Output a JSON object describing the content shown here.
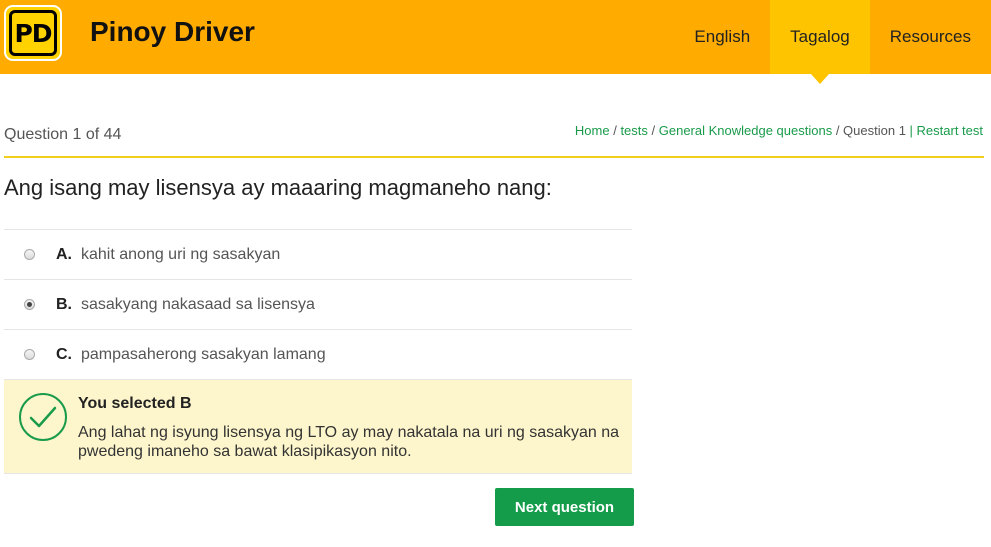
{
  "header": {
    "logo_text": "PD",
    "brand": "Pinoy Driver",
    "logo_color": "#ffd200",
    "bar_color": "#ffab00",
    "nav": [
      {
        "label": "English",
        "active": false
      },
      {
        "label": "Tagalog",
        "active": true
      },
      {
        "label": "Resources",
        "active": false
      }
    ]
  },
  "quiz": {
    "progress": "Question 1 of 44",
    "breadcrumb": {
      "home": "Home",
      "sep": " / ",
      "tests": "tests",
      "category": "General Knowledge questions",
      "current": "Question 1",
      "bar": " | ",
      "restart": "Restart test"
    },
    "question": "Ang isang may lisensya ay maaaring magmaneho nang:",
    "options": [
      {
        "letter": "A.",
        "text": "kahit anong uri ng sasakyan",
        "selected": false
      },
      {
        "letter": "B.",
        "text": "sasakyang nakasaad sa lisensya",
        "selected": true
      },
      {
        "letter": "C.",
        "text": "pampasaherong sasakyan lamang",
        "selected": false
      }
    ],
    "feedback": {
      "icon": "check-circle-icon",
      "title": "You selected B",
      "text": "Ang lahat ng isyung lisensya ng LTO ay may nakatala na uri ng sasakyan na pwedeng imaneho sa bawat klasipikasyon nito."
    },
    "next_label": "Next question",
    "accent_color": "#149c4a"
  }
}
